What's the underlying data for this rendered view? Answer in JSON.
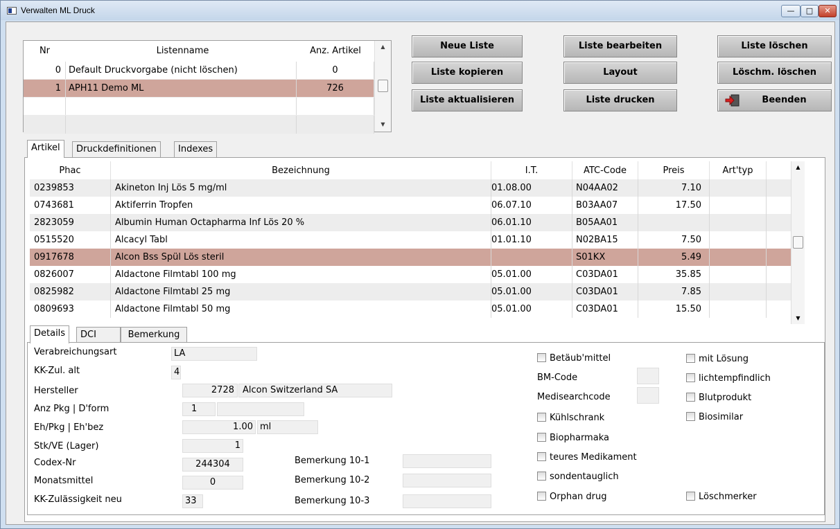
{
  "window": {
    "title": "Verwalten ML Druck"
  },
  "lists": {
    "headers": {
      "nr": "Nr",
      "name": "Listenname",
      "count": "Anz. Artikel"
    },
    "rows": [
      {
        "nr": "0",
        "name": "Default Druckvorgabe (nicht löschen)",
        "count": "0"
      },
      {
        "nr": "1",
        "name": "APH11 Demo ML",
        "count": "726"
      }
    ]
  },
  "buttons": {
    "neue_liste": "Neue Liste",
    "liste_bearbeiten": "Liste bearbeiten",
    "liste_loeschen": "Liste löschen",
    "liste_kopieren": "Liste kopieren",
    "layout": "Layout",
    "loeschm_loeschen": "Löschm. löschen",
    "liste_aktualisieren": "Liste aktualisieren",
    "liste_drucken": "Liste drucken",
    "beenden": "Beenden"
  },
  "tabs": {
    "artikel": "Artikel",
    "druckdefinitionen": "Druckdefinitionen",
    "indexes": "Indexes"
  },
  "articles": {
    "headers": {
      "phac": "Phac",
      "bezeichnung": "Bezeichnung",
      "it": "I.T.",
      "atc": "ATC-Code",
      "preis": "Preis",
      "arttyp": "Art'typ"
    },
    "rows": [
      {
        "phac": "0239853",
        "bez": "Akineton Inj Lös 5 mg/ml",
        "it": "01.08.00",
        "atc": "N04AA02",
        "preis": "7.10"
      },
      {
        "phac": "0743681",
        "bez": "Aktiferrin Tropfen",
        "it": "06.07.10",
        "atc": "B03AA07",
        "preis": "17.50"
      },
      {
        "phac": "2823059",
        "bez": "Albumin Human Octapharma Inf Lös 20 %",
        "it": "06.01.10",
        "atc": "B05AA01",
        "preis": ""
      },
      {
        "phac": "0515520",
        "bez": "Alcacyl Tabl",
        "it": "01.01.10",
        "atc": "N02BA15",
        "preis": "7.50"
      },
      {
        "phac": "0917678",
        "bez": "Alcon Bss Spül Lös steril",
        "it": "",
        "atc": "S01KX",
        "preis": "5.49"
      },
      {
        "phac": "0826007",
        "bez": "Aldactone Filmtabl 100 mg",
        "it": "05.01.00",
        "atc": "C03DA01",
        "preis": "35.85"
      },
      {
        "phac": "0825982",
        "bez": "Aldactone Filmtabl 25 mg",
        "it": "05.01.00",
        "atc": "C03DA01",
        "preis": "7.85"
      },
      {
        "phac": "0809693",
        "bez": "Aldactone Filmtabl 50 mg",
        "it": "05.01.00",
        "atc": "C03DA01",
        "preis": "15.50"
      }
    ]
  },
  "subtabs": {
    "details": "Details",
    "dci": "DCI",
    "bemerkung": "Bemerkung"
  },
  "details": {
    "verabreichungsart_label": "Verabreichungsart",
    "verabreichungsart": "LA",
    "kk_zul_alt_label": "KK-Zul. alt",
    "kk_zul_alt": "4",
    "hersteller_label": "Hersteller",
    "hersteller_nr": "2728",
    "hersteller_name": "Alcon Switzerland SA",
    "anz_pkg_label": "Anz Pkg | D'form",
    "anz_pkg": "1",
    "dform": "",
    "eh_pkg_label": "Eh/Pkg | Eh'bez",
    "eh_pkg": "1.00",
    "eh_bez": "ml",
    "stk_ve_label": "Stk/VE (Lager)",
    "stk_ve": "1",
    "codex_label": "Codex-Nr",
    "codex": "244304",
    "monatsmittel_label": "Monatsmittel",
    "monatsmittel": "0",
    "kk_neu_label": "KK-Zulässigkeit neu",
    "kk_neu": "33",
    "bem1_label": "Bemerkung 10-1",
    "bem1": "",
    "bem2_label": "Bemerkung 10-2",
    "bem2": "",
    "bem3_label": "Bemerkung 10-3",
    "bem3": "",
    "bm_code_label": "BM-Code",
    "bm_code": "",
    "medisearch_label": "Medisearchcode",
    "medisearch": "",
    "cb_betaeubmittel": "Betäub'mittel",
    "cb_kuehlschrank": "Kühlschrank",
    "cb_biopharmaka": "Biopharmaka",
    "cb_teures": "teures Medikament",
    "cb_sonden": "sondentauglich",
    "cb_orphan": "Orphan drug",
    "cb_mit_loesung": "mit Lösung",
    "cb_licht": "lichtempfindlich",
    "cb_blut": "Blutprodukt",
    "cb_biosimilar": "Biosimilar",
    "cb_loeschmerker": "Löschmerker"
  }
}
